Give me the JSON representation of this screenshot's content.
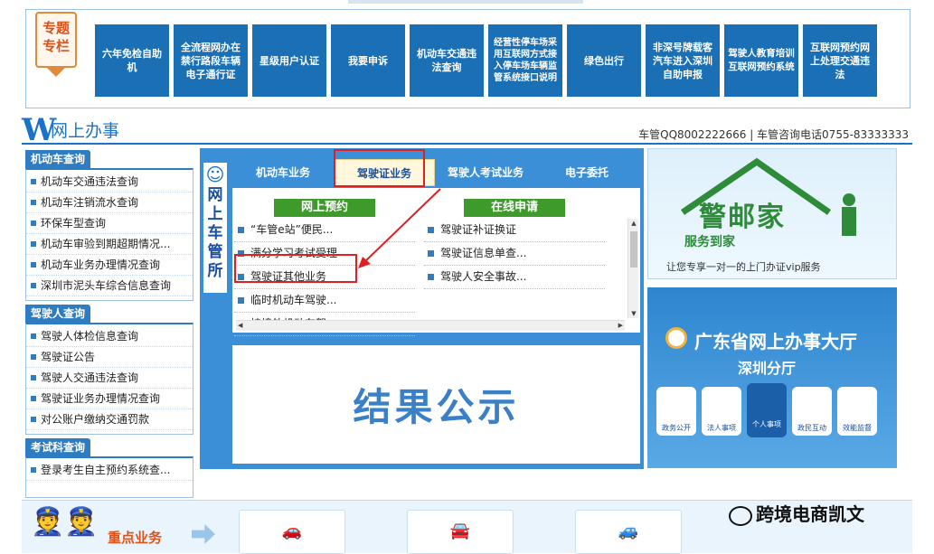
{
  "special": {
    "label": "专题\n专栏",
    "tiles": [
      "六年免检自助机",
      "全流程网办在禁行路段车辆电子通行证",
      "星级用户认证",
      "我要申诉",
      "机动车交通违法查询",
      "经营性停车场采用互联网方式接入停车场车辆监管系统接口说明",
      "绿色出行",
      "非深号牌载客汽车进入深圳自助申报",
      "驾驶人教育培训互联网预约系统",
      "互联网预约网上处理交通违法"
    ]
  },
  "header": {
    "w_letter": "W",
    "title": "网上办事",
    "contact": "车管QQ8002222666 | 车管咨询电话0755-83333333"
  },
  "sidebar": {
    "groups": [
      {
        "title": "机动车查询",
        "items": [
          "机动车交通违法查询",
          "机动车注销流水查询",
          "环保车型查询",
          "机动车审验到期超期情况...",
          "机动车业务办理情况查询",
          "深圳市泥头车综合信息查询"
        ]
      },
      {
        "title": "驾驶人查询",
        "items": [
          "驾驶人体检信息查询",
          "驾驶证公告",
          "驾驶人交通违法查询",
          "驾驶证业务办理情况查询",
          "对公账户缴纳交通罚款"
        ]
      },
      {
        "title": "考试科查询",
        "items": [
          "登录考生自主预约系统查..."
        ]
      }
    ]
  },
  "center": {
    "vertical_title": [
      "网",
      "上",
      "车",
      "管",
      "所"
    ],
    "tabs": [
      "机动车业务",
      "驾驶证业务",
      "驾驶人考试业务",
      "电子委托"
    ],
    "active_tab": "驾驶证业务",
    "left_column": {
      "title": "网上预约",
      "items": [
        "“车管e站”便民...",
        "满分学习考试受理",
        "驾驶证其他业务",
        "临时机动车驾驶...",
        "持境外机动车驾..."
      ]
    },
    "right_column": {
      "title": "在线申请",
      "items": [
        "驾驶证补证换证",
        "驾驶证信息单查...",
        "驾驶人安全事故..."
      ]
    },
    "result_text": "结果公示"
  },
  "banners": {
    "b1_title": "警邮家",
    "b1_sub": "服务到家",
    "b1_foot": "让您专享一对一的上门办证vip服务",
    "b2_title": "广东省网上办事大厅",
    "b2_sub": "深圳分厅",
    "b2_icons": [
      "政务公开",
      "法人事项",
      "个人事项",
      "政民互动",
      "效能监督"
    ]
  },
  "bottom": {
    "key_title": "重点业务",
    "watermark": "跨境电商凯文"
  },
  "colors": {
    "tile_blue": "#1a6fb5",
    "accent_red": "#e02020",
    "green": "#3e9b2b"
  }
}
